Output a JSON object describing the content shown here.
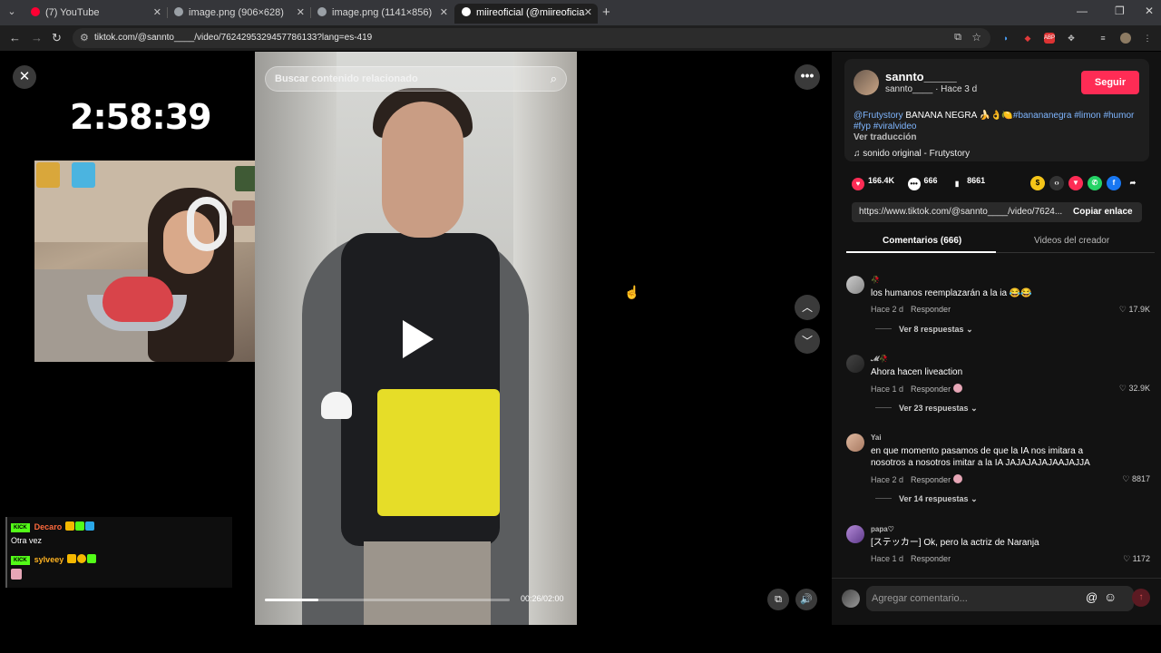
{
  "browser": {
    "tabs": [
      {
        "title": "(7) YouTube",
        "color": "#ff0033"
      },
      {
        "title": "image.png (906×628)",
        "color": "#9aa0a6"
      },
      {
        "title": "image.png (1141×856)",
        "color": "#9aa0a6"
      },
      {
        "title": "miireoficial (@miireoficial) | Tik",
        "color": "#ffffff"
      }
    ],
    "url": "tiktok.com/@sannto____/video/7624295329457786133?lang=es-419"
  },
  "stream": {
    "timer": "2:58:39",
    "chat": [
      {
        "platform": "KICK",
        "user": "Decaro",
        "message": "Otra vez"
      },
      {
        "platform": "KICK",
        "user": "sylveey",
        "message": ""
      }
    ]
  },
  "video": {
    "search_placeholder": "Buscar contenido relacionado",
    "progress": 0.217,
    "time": "00:26/02:00"
  },
  "post": {
    "author": "sannto_____",
    "handle": "sannto____",
    "posted": "· Hace 3 d",
    "follow_label": "Seguir",
    "desc_parts": [
      "@Frutystory",
      " BANANA NEGRA 🍌👌🍋",
      "#banananegra",
      " ",
      "#limon",
      " ",
      "#humor",
      " ",
      "#fyp",
      " ",
      "#viralvideo"
    ],
    "translate": "Ver traducción",
    "sound": "sonido original - Frutystory",
    "likes": "166.4K",
    "comments": "666",
    "saves": "8661",
    "link": "https://www.tiktok.com/@sannto____/video/7624...",
    "copy_label": "Copiar enlace",
    "accent": "#fe2c55"
  },
  "panel_tabs": {
    "comments": "Comentarios (666)",
    "creator_videos": "Videos del creador"
  },
  "comments": [
    {
      "user": "🥀",
      "text": "los humanos reemplazarán a la ia 😂😂",
      "time": "Hace 2 d",
      "reply": "Responder",
      "likes": "17.9K",
      "replies": "Ver 8 respuestas"
    },
    {
      "user": "𝓜🥀",
      "text": "Ahora hacen liveaction",
      "time": "Hace 1 d",
      "reply": "Responder",
      "likes": "32.9K",
      "replies": "Ver 23 respuestas"
    },
    {
      "user": "Yai",
      "text": "en que momento pasamos de que la IA nos imitara a nosotros a nosotros imitar a la IA JAJAJAJAJAAJAJJA",
      "time": "Hace 2 d",
      "reply": "Responder",
      "likes": "8817",
      "replies": "Ver 14 respuestas"
    },
    {
      "user": "papa♡",
      "text": "[ステッカー] Ok, pero la actriz de Naranja",
      "time": "Hace 1 d",
      "reply": "Responder",
      "likes": "1172",
      "replies": ""
    }
  ],
  "compose": {
    "placeholder": "Agregar comentario..."
  }
}
